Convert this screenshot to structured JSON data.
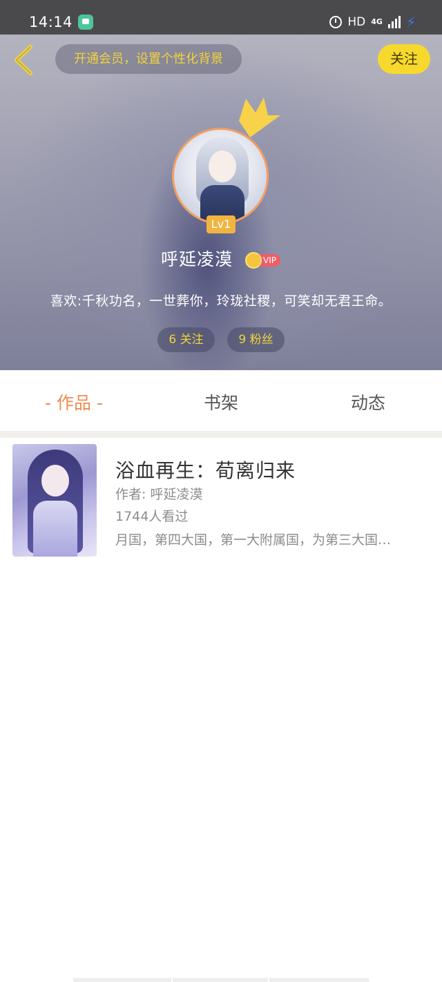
{
  "status_bar": {
    "time": "14:14",
    "hd": "HD",
    "network": "4G"
  },
  "header": {
    "vip_banner": "开通会员，设置个性化背景",
    "follow_label": "关注"
  },
  "profile": {
    "level": "Lv1",
    "username": "呼延凌漠",
    "vip_tag": "VIP",
    "bio": "喜欢:千秋功名，一世葬你，玲珑社稷，可笑却无君王命。",
    "following": "6 关注",
    "fans": "9 粉丝"
  },
  "tabs": [
    {
      "label": "- 作品 -",
      "active": true
    },
    {
      "label": "书架",
      "active": false
    },
    {
      "label": "动态",
      "active": false
    }
  ],
  "books": [
    {
      "title": "浴血再生：荀离归来",
      "author": "作者: 呼延凌漠",
      "views": "1744人看过",
      "description": "月国，第四大国，第一大附属国，为第三大国…"
    }
  ],
  "colors": {
    "accent_yellow": "#f7d92e",
    "tab_active": "#ef8b4e",
    "level_badge": "#f2b441",
    "vip_tag": "#ee5e67"
  },
  "icons": [
    "message-icon",
    "alarm-icon",
    "signal-icon",
    "charging-icon",
    "back-icon",
    "crown-icon"
  ]
}
